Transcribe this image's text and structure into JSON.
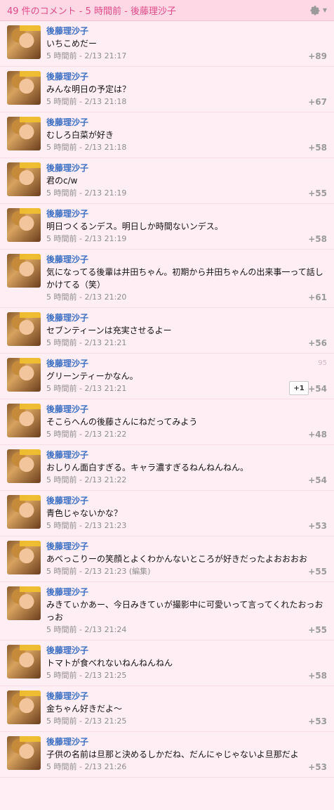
{
  "header": {
    "title": "49 件のコメント - 5 時間前 - 後藤理沙子"
  },
  "ui": {
    "settings_icon": "gear-icon"
  },
  "comments": [
    {
      "author": "後藤理沙子",
      "text": "いちこめだー",
      "time": "5 時間前 - 2/13 21:17",
      "score": "+89"
    },
    {
      "author": "後藤理沙子",
      "text": "みんな明日の予定は？",
      "time": "5 時間前 - 2/13 21:18",
      "score": "+67"
    },
    {
      "author": "後藤理沙子",
      "text": "むしろ白菜が好き",
      "time": "5 時間前 - 2/13 21:18",
      "score": "+58"
    },
    {
      "author": "後藤理沙子",
      "text": "君のc/w",
      "time": "5 時間前 - 2/13 21:19",
      "score": "+55"
    },
    {
      "author": "後藤理沙子",
      "text": "明日つくるンデス。明日しか時間ないンデス。",
      "time": "5 時間前 - 2/13 21:19",
      "score": "+58"
    },
    {
      "author": "後藤理沙子",
      "text": "気になってる後輩は井田ちゃん。初期から井田ちゃんの出来事一って話しかけてる（笑）",
      "time": "5 時間前 - 2/13 21:20",
      "score": "+61"
    },
    {
      "author": "後藤理沙子",
      "text": "セブンティーンは充実させるよー",
      "time": "5 時間前 - 2/13 21:21",
      "score": "+56"
    },
    {
      "author": "後藤理沙子",
      "text": "グリーンティーかなん。",
      "time": "5 時間前 - 2/13 21:21",
      "score": "+54",
      "faint": "95",
      "plus": "+1"
    },
    {
      "author": "後藤理沙子",
      "text": "そこらへんの後藤さんにねだってみよう",
      "time": "5 時間前 - 2/13 21:22",
      "score": "+48"
    },
    {
      "author": "後藤理沙子",
      "text": "おしりん面白すぎる。キャラ濃すぎるねんねんねん。",
      "time": "5 時間前 - 2/13 21:22",
      "score": "+54"
    },
    {
      "author": "後藤理沙子",
      "text": "青色じゃないかな？",
      "time": "5 時間前 - 2/13 21:23",
      "score": "+53"
    },
    {
      "author": "後藤理沙子",
      "text": "あべっこりーの笑顔とよくわかんないところが好きだったよおおおお",
      "time": "5 時間前 - 2/13 21:23",
      "edit": "(編集)",
      "score": "+55"
    },
    {
      "author": "後藤理沙子",
      "text": "みきてぃかあー、今日みきてぃが撮影中に可愛いって言ってくれたおっおっお",
      "time": "5 時間前 - 2/13 21:24",
      "score": "+55"
    },
    {
      "author": "後藤理沙子",
      "text": "トマトが食べれないねんねんねん",
      "time": "5 時間前 - 2/13 21:25",
      "score": "+58"
    },
    {
      "author": "後藤理沙子",
      "text": "金ちゃん好きだよ〜",
      "time": "5 時間前 - 2/13 21:25",
      "score": "+53"
    },
    {
      "author": "後藤理沙子",
      "text": "子供の名前は旦那と決めるしかだね、だんにゃじゃないよ旦那だよ",
      "time": "5 時間前 - 2/13 21:26",
      "score": "+53"
    }
  ]
}
